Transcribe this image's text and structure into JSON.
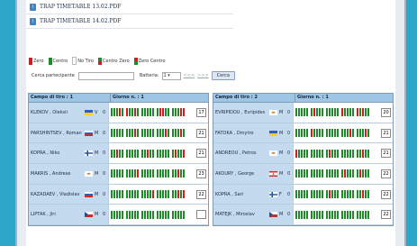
{
  "pdf_files": [
    {
      "label": "TRAP TIMETABLE 13.02.PDF",
      "icon": "pdf-icon"
    },
    {
      "label": "TRAP TIMETABLE 14.02.PDF",
      "icon": "pdf-icon"
    }
  ],
  "legend": [
    {
      "label": "Zero",
      "colors": [
        "#cc1f1f"
      ]
    },
    {
      "label": "Centro",
      "colors": [
        "#1f8a2a"
      ]
    },
    {
      "label": "No Tiro",
      "colors": [
        "#ffffff"
      ]
    },
    {
      "label": "Centro Zero",
      "colors": [
        "#1f8a2a",
        "#cc1f1f"
      ]
    },
    {
      "label": "Zero Centro",
      "colors": [
        "#cc1f1f",
        "#1f8a2a"
      ]
    }
  ],
  "search": {
    "label": "Cerca partecipante",
    "value": "",
    "batteria_label": "Batteria:",
    "batteria_value": "1",
    "prev_link": "<<<",
    "next_link": ">>>",
    "button": "Cerca"
  },
  "tables": [
    {
      "header_field": "Campo di tiro : 1",
      "header_round": "Giorno n. : 1",
      "rows": [
        {
          "name": "KLEKOV , Oleksii",
          "flag": "ukraine",
          "category": "V",
          "zero": "0",
          "total": "17",
          "shots": "GGGRGRGGRGGGGGGGRRGGGGGRR"
        },
        {
          "name": "PARSHINTSEV , Roman",
          "flag": "russia",
          "category": "M",
          "zero": "0",
          "total": "21",
          "shots": "GGGGGGGGRGGGGGGGGGRGGGGRG"
        },
        {
          "name": "KOPRA , Niko",
          "flag": "finland",
          "category": "M",
          "zero": "0",
          "total": "21",
          "shots": "GGRGGGGGGGGGRGGGGGGGGRGGR"
        },
        {
          "name": "MAKRIS , Andreas",
          "flag": "cyprus",
          "category": "M",
          "zero": "0",
          "total": "23",
          "shots": "GGGGGGGGGRGGGGGGGGGGGGRGG"
        },
        {
          "name": "KAZADAEV , Vladislav",
          "flag": "russia",
          "category": "M",
          "zero": "0",
          "total": "22",
          "shots": "GGGGGGGGGGGGGGRGGGGGGGRGR"
        },
        {
          "name": "LIPTAK , Jiri",
          "flag": "czech",
          "category": "M",
          "zero": "0",
          "total": "",
          "shots": "GGGGGGGGGGGGGGGGGGGGGGGGG"
        }
      ]
    },
    {
      "header_field": "Campo di tiro : 2",
      "header_round": "Giorno n. : 1",
      "rows": [
        {
          "name": "EVRIPIDOU , Evripides",
          "flag": "cyprus",
          "category": "M",
          "zero": "0",
          "total": "20",
          "shots": "GGGGGGRGGGGGGGGRGGGGRGRGG"
        },
        {
          "name": "FATOKA , Dmytro",
          "flag": "ukraine",
          "category": "M",
          "zero": "0",
          "total": "21",
          "shots": "GGGGGRGGGGGGGGGGGGRGGGGRG"
        },
        {
          "name": "ANDREOU , Petros",
          "flag": "cyprus",
          "category": "M",
          "zero": "0",
          "total": "21",
          "shots": "RGGGGGGGGGGRGGGGGGGGGGRGG"
        },
        {
          "name": "AKOURY , George",
          "flag": "lebanon",
          "category": "M",
          "zero": "0",
          "total": "22",
          "shots": "GGGGGGGGGGGGGGGGRGGGGRGGG"
        },
        {
          "name": "KOPRA , Sari",
          "flag": "finland",
          "category": "F",
          "zero": "0",
          "total": "22",
          "shots": "GGGGGGGGGGGRGGGGGGGGGGRGG"
        },
        {
          "name": "MATEJK , Miroslav",
          "flag": "czech",
          "category": "M",
          "zero": "0",
          "total": "22",
          "shots": "GGGGGGGGGGGGGGGGGGGGGGGGG"
        }
      ]
    }
  ],
  "colors": {
    "hit": "#1f8a2a",
    "miss": "#cc1f1f",
    "header": "#9ec6e4",
    "name_cell": "#c4daee",
    "background": "#2ea6c7"
  }
}
